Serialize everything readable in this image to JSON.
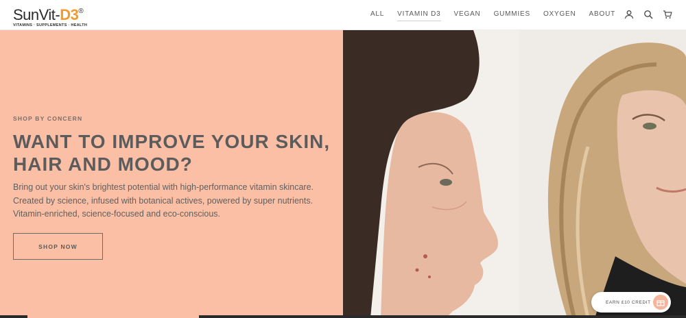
{
  "brand": {
    "name_prefix": "SunVit-",
    "name_accent": "D3",
    "registered": "®",
    "tagline": "VITAMINS · SUPPLEMENTS · HEALTH",
    "accent_color": "#f29a2e"
  },
  "nav": {
    "items": [
      {
        "label": "ALL"
      },
      {
        "label": "VITAMIN D3",
        "active": true
      },
      {
        "label": "VEGAN"
      },
      {
        "label": "GUMMIES"
      },
      {
        "label": "OXYGEN"
      },
      {
        "label": "ABOUT"
      }
    ],
    "icons": [
      "user-icon",
      "search-icon",
      "cart-icon"
    ]
  },
  "hero": {
    "eyebrow": "SHOP BY CONCERN",
    "headline": "WANT TO IMPROVE YOUR SKIN, HAIR AND MOOD?",
    "body": "Bring out your skin's brightest potential with high-performance vitamin skincare. Created by science, infused with botanical actives, powered by super nutrients. Vitamin-enriched, science-focused and eco-conscious.",
    "cta_label": "SHOP NOW",
    "background_color": "#fbbfa5"
  },
  "rewards": {
    "label": "EARN £10 CREDIT",
    "icon": "gift-icon"
  }
}
